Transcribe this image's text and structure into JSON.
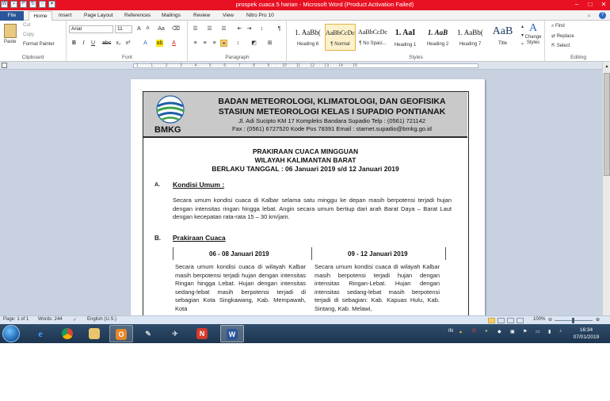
{
  "window": {
    "title": "prospek cuaca 5 harian  -  Microsoft Word (Product Activation Failed)",
    "quick_access": [
      "save",
      "undo",
      "redo",
      "print",
      "customize"
    ],
    "buttons": [
      "−",
      "□",
      "✕"
    ]
  },
  "ribbon_tabs": [
    "File",
    "Home",
    "Insert",
    "Page Layout",
    "References",
    "Mailings",
    "Review",
    "View",
    "Nitro Pro 10"
  ],
  "clipboard": {
    "paste": "Paste",
    "cut": "Cut",
    "copy": "Copy",
    "format_painter": "Format Painter",
    "label": "Clipboard"
  },
  "font": {
    "name": "Arial",
    "size": "11",
    "label": "Font"
  },
  "paragraph": {
    "label": "Paragraph"
  },
  "styles": {
    "label": "Styles",
    "items": [
      {
        "preview": "1. AaBb(",
        "name": "Heading 6"
      },
      {
        "preview": "AaBbCcDc",
        "name": "¶ Normal"
      },
      {
        "preview": "AaBbCcDc",
        "name": "¶ No Spaci..."
      },
      {
        "preview": "1. AaI",
        "name": "Heading 1"
      },
      {
        "preview": "1. AaB",
        "name": "Heading 2"
      },
      {
        "preview": "1. AaBb(",
        "name": "Heading 7"
      },
      {
        "preview": "AaB",
        "name": "Title"
      }
    ],
    "change_styles": "Change Styles"
  },
  "editing": {
    "find": "Find",
    "replace": "Replace",
    "select": "Select",
    "label": "Editing"
  },
  "ruler_ticks": "1 · · · · 1 · · · · 2 · · · · 3 · · · · 4 · · · · 5 · · · · 6 · · · · 7 · · · · 8 · · · · 9 · · · · 10 · · · 11 · · · 12 · · · 13 · · · 14 · · · 15",
  "document": {
    "agency": "BADAN METEOROLOGI, KLIMATOLOGI, DAN GEOFISIKA",
    "station": "STASIUN METEOROLOGI KELAS  I  SUPADIO PONTIANAK",
    "address": "Jl. Adi Sucipto KM 17 Kompleks Bandara  Supadio   Telp : (0561) 721142",
    "contact": "Fax : (0561) 6727520    Kode Pos 78391      Email : starnet.supadio@bmkg.go.id",
    "logo_text": "BMKG",
    "title1": "PRAKIRAAN CUACA MINGGUAN",
    "title2": "WILAYAH KALIMANTAN BARAT",
    "title3": "BERLAKU TANGGAL :  06  Januari 2019 s/d  12 Januari 2019",
    "section_a_num": "A.",
    "section_a_title": "Kondisi Umum :",
    "section_a_text": "Secara umum kondisi cuaca di Kalbar selama satu minggu ke depan masih berpotensi terjadi hujan dengan intensitas ringan hingga lebat.  Angin secara umum bertiup dari arah Barat Daya – Barat Laut dengan kecepatan rata-rata 15 – 30 km/jam.",
    "section_b_num": "B.",
    "section_b_title": "Prakiraan Cuaca",
    "col1_header": "06 - 08 Januari 2019",
    "col2_header": "09 - 12 Januari 2019",
    "col1_text": "Secara umum kondisi cuaca di wilayah Kalbar masih berpotensi terjadi hujan dengan intensitas Ringan hingga Lebat. Hujan dengan intensitas sedang-lebat masih berpotensi terjadi di sebagian Kota Singkawang, Kab. Mempawah, Kota",
    "col2_text": "Secara umum kondisi cuaca di wilayah Kalbar masih berpotensi terjadi hujan dengan intensitas Ringan-Lebat. Hujan dengan intensitas sedang-lebat masih berpotensi terjadi di sebagian: Kab. Kapuas Hulu, Kab. Sintang, Kab. Melawi,"
  },
  "status": {
    "page": "Page: 1 of 1",
    "words": "Words: 244",
    "language": "English (U.S.)",
    "zoom": "100%"
  },
  "taskbar": {
    "lang": "IN",
    "time": "16:34",
    "date": "07/01/2019"
  },
  "colors": {
    "titlebar": "#e81123",
    "file_tab": "#2a5699",
    "header_fill": "#c9c9c9",
    "workspace": "#c7d1e0",
    "taskbar": "#1c3550"
  }
}
